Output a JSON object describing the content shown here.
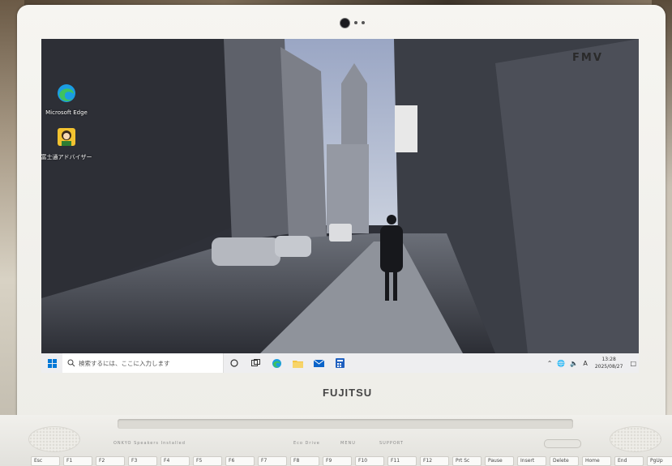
{
  "bezel": {
    "corner_label": "FMV",
    "brand": "FUJITSU"
  },
  "desktop": {
    "icons": [
      {
        "label": "Microsoft Edge",
        "icon": "edge-icon"
      },
      {
        "label": "富士通アドバイザー",
        "icon": "fujitsu-advisor-icon"
      }
    ]
  },
  "taskbar": {
    "search_placeholder": "検索するには、ここに入力します",
    "apps": [
      "cortana-icon",
      "task-view-icon",
      "edge-icon",
      "file-explorer-icon",
      "mail-icon",
      "calculator-icon"
    ],
    "tray": {
      "ime": "A",
      "time": "13:28",
      "date": "2025/08/27"
    }
  },
  "base": {
    "speaker_label": "ONKYO Speakers Installed",
    "indicators": [
      "Eco Drive",
      "MENU",
      "SUPPORT"
    ],
    "keys": [
      "Esc",
      "F1",
      "F2",
      "F3",
      "F4",
      "F5",
      "F6",
      "F7",
      "F8",
      "F9",
      "F10",
      "F11",
      "F12",
      "Prt Sc",
      "Pause",
      "Insert",
      "Delete",
      "Home",
      "End",
      "PgUp"
    ]
  },
  "colors": {
    "bezel": "#f4f3ef",
    "taskbar": "#eeeef0",
    "accent": "#0078d7"
  }
}
